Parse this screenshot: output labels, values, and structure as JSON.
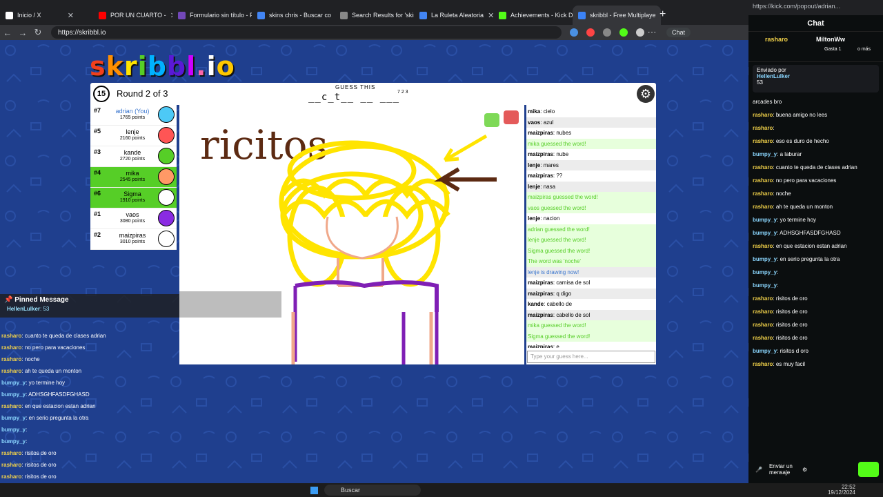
{
  "browser": {
    "tabs": [
      {
        "title": "Inicio / X",
        "color": "#ffffff"
      },
      {
        "title": "POR UN CUARTO -",
        "color": "#ff0000"
      },
      {
        "title": "Formulario sin título - Fo",
        "color": "#7248b9"
      },
      {
        "title": "skins chris - Buscar con",
        "color": "#4285f4"
      },
      {
        "title": "Search Results for 'skin",
        "color": "#888888"
      },
      {
        "title": "La Ruleta Aleatoria",
        "color": "#4285f4"
      },
      {
        "title": "Achievements - Kick Da",
        "color": "#53fc18"
      },
      {
        "title": "skribbl - Free Multiplaye",
        "color": "#3b82f6"
      }
    ],
    "url": "https://skribbl.io",
    "chat_button": "Chat",
    "window_controls": [
      "—",
      "☐",
      "✕"
    ]
  },
  "game": {
    "logo": "skribbl.io",
    "logo_colors": [
      "#f2401c",
      "#ff8e00",
      "#ffe400",
      "#56ce27",
      "#00b2ff",
      "#5a19d6",
      "#cc00ff",
      "#ff66aa",
      "#ffffff",
      "#ffc800"
    ],
    "timer": "15",
    "round_text": "Round 2 of 3",
    "guess_label": "GUESS THIS",
    "word_hint": "__c_t__ __ ___",
    "word_lengths": "7 2 3",
    "settings_icon": "gear-icon",
    "players": [
      {
        "rank": "#7",
        "name": "adrian (You)",
        "points": "1765 points",
        "guessed": false,
        "color": "#4dc9f6"
      },
      {
        "rank": "#5",
        "name": "lenje",
        "points": "2160 points",
        "guessed": false,
        "color": "#ff5555"
      },
      {
        "rank": "#3",
        "name": "kande",
        "points": "2720 points",
        "guessed": false,
        "color": "#56ce27"
      },
      {
        "rank": "#4",
        "name": "mika",
        "points": "2545 points",
        "guessed": true,
        "color": "#ff9966"
      },
      {
        "rank": "#6",
        "name": "Sigma",
        "points": "1910 points",
        "guessed": true,
        "color": "#ffffff"
      },
      {
        "rank": "#1",
        "name": "vaos",
        "points": "3080 points",
        "guessed": false,
        "color": "#8a2be2"
      },
      {
        "rank": "#2",
        "name": "maizpiras",
        "points": "3010 points",
        "guessed": false,
        "color": "#ffffff"
      }
    ],
    "canvas_text": "ricitos",
    "chat": [
      {
        "user": "mika",
        "text": "cielo",
        "type": "msg"
      },
      {
        "user": "vaos",
        "text": "azul",
        "type": "msg"
      },
      {
        "user": "maizpiras",
        "text": "nubes",
        "type": "msg"
      },
      {
        "user": "",
        "text": "mika guessed the word!",
        "type": "guess"
      },
      {
        "user": "maizpiras",
        "text": "nube",
        "type": "msg"
      },
      {
        "user": "lenje",
        "text": "mares",
        "type": "msg"
      },
      {
        "user": "maizpiras",
        "text": "??",
        "type": "msg"
      },
      {
        "user": "lenje",
        "text": "nasa",
        "type": "msg"
      },
      {
        "user": "",
        "text": "maizpiras guessed the word!",
        "type": "guess"
      },
      {
        "user": "",
        "text": "vaos guessed the word!",
        "type": "guess"
      },
      {
        "user": "lenje",
        "text": "nacion",
        "type": "msg"
      },
      {
        "user": "",
        "text": "adrian guessed the word!",
        "type": "guess"
      },
      {
        "user": "",
        "text": "lenje guessed the word!",
        "type": "guess"
      },
      {
        "user": "",
        "text": "Sigma guessed the word!",
        "type": "guess"
      },
      {
        "user": "",
        "text": "The word was 'noche'",
        "type": "guess"
      },
      {
        "user": "",
        "text": "lenje is drawing now!",
        "type": "draw"
      },
      {
        "user": "maizpiras",
        "text": "camisa de sol",
        "type": "msg"
      },
      {
        "user": "maizpiras",
        "text": "q digo",
        "type": "msg"
      },
      {
        "user": "kande",
        "text": "cabello de",
        "type": "msg"
      },
      {
        "user": "maizpiras",
        "text": "cabello de sol",
        "type": "msg"
      },
      {
        "user": "",
        "text": "mika guessed the word!",
        "type": "guess"
      },
      {
        "user": "",
        "text": "Sigma guessed the word!",
        "type": "guess"
      },
      {
        "user": "maizpiras",
        "text": "e",
        "type": "msg"
      }
    ],
    "guess_placeholder": "Type your guess here..."
  },
  "overlay": {
    "pinned_title": "Pinned Message",
    "pinned_user": "HellenLulker",
    "pinned_text": "53",
    "messages": [
      {
        "user": "rasharo",
        "text": "cuanto te queda de clases adrian",
        "b": false
      },
      {
        "user": "rasharo",
        "text": "no pero para vacaciones",
        "b": false
      },
      {
        "user": "rasharo",
        "text": "noche",
        "b": false
      },
      {
        "user": "rasharo",
        "text": "ah te queda un monton",
        "b": false
      },
      {
        "user": "bumpy_y",
        "text": "yo termine hoy",
        "b": true
      },
      {
        "user": "bumpy_y",
        "text": "ADHSGHFASDFGHASD",
        "b": true
      },
      {
        "user": "rasharo",
        "text": "en que estacion estan adrian",
        "b": false
      },
      {
        "user": "bumpy_y",
        "text": "en serio pregunta la otra",
        "b": true
      },
      {
        "user": "bumpy_y",
        "text": "",
        "b": true
      },
      {
        "user": "bumpy_y",
        "text": "",
        "b": true
      },
      {
        "user": "rasharo",
        "text": "risitos de oro",
        "b": false
      },
      {
        "user": "rasharo",
        "text": "risitos de oro",
        "b": false
      },
      {
        "user": "rasharo",
        "text": "risitos de oro",
        "b": false
      },
      {
        "user": "rasharo",
        "text": "risitos de oro",
        "b": false
      },
      {
        "user": "bumpy_y",
        "text": "risitos d oro",
        "b": true
      },
      {
        "user": "rasharo",
        "text": "es muy facil",
        "b": false
      }
    ]
  },
  "kick": {
    "url": "https://kick.com/popout/adrian...",
    "title": "Chat",
    "top_user1": "rasharo",
    "top_user2": "MiltonWw",
    "top_sub": "Gasta 1",
    "top_more": "o más",
    "pin_by": "Enviado por",
    "pin_user": "HellenLulker",
    "pin_text": "53",
    "messages": [
      {
        "user": "",
        "text": "arcades bro",
        "b": false
      },
      {
        "user": "rasharo",
        "text": "buena amigo no lees",
        "b": false
      },
      {
        "user": "rasharo",
        "text": "",
        "b": false
      },
      {
        "user": "rasharo",
        "text": "eso es duro de hecho",
        "b": false
      },
      {
        "user": "bumpy_y",
        "text": "a laburar",
        "b": true
      },
      {
        "user": "rasharo",
        "text": "cuanto te queda de clases adrian",
        "b": false
      },
      {
        "user": "rasharo",
        "text": "no pero para vacaciones",
        "b": false
      },
      {
        "user": "rasharo",
        "text": "noche",
        "b": false
      },
      {
        "user": "rasharo",
        "text": "ah te queda un monton",
        "b": false
      },
      {
        "user": "bumpy_y",
        "text": "yo termine hoy",
        "b": true
      },
      {
        "user": "bumpy_y",
        "text": "ADHSGHFASDFGHASD",
        "b": true
      },
      {
        "user": "rasharo",
        "text": "en que estacion estan adrian",
        "b": false
      },
      {
        "user": "bumpy_y",
        "text": "en serio pregunta la otra",
        "b": true
      },
      {
        "user": "bumpy_y",
        "text": "",
        "b": true
      },
      {
        "user": "bumpy_y",
        "text": "",
        "b": true
      },
      {
        "user": "rasharo",
        "text": "risitos de oro",
        "b": false
      },
      {
        "user": "rasharo",
        "text": "risitos de oro",
        "b": false
      },
      {
        "user": "rasharo",
        "text": "risitos de oro",
        "b": false
      },
      {
        "user": "rasharo",
        "text": "risitos de oro",
        "b": false
      },
      {
        "user": "bumpy_y",
        "text": "risitos d oro",
        "b": true
      },
      {
        "user": "rasharo",
        "text": "es muy facil",
        "b": false
      }
    ],
    "send_label": "Enviar un mensaje"
  },
  "taskbar": {
    "search": "Buscar",
    "time": "22:52",
    "date": "19/12/2024"
  }
}
